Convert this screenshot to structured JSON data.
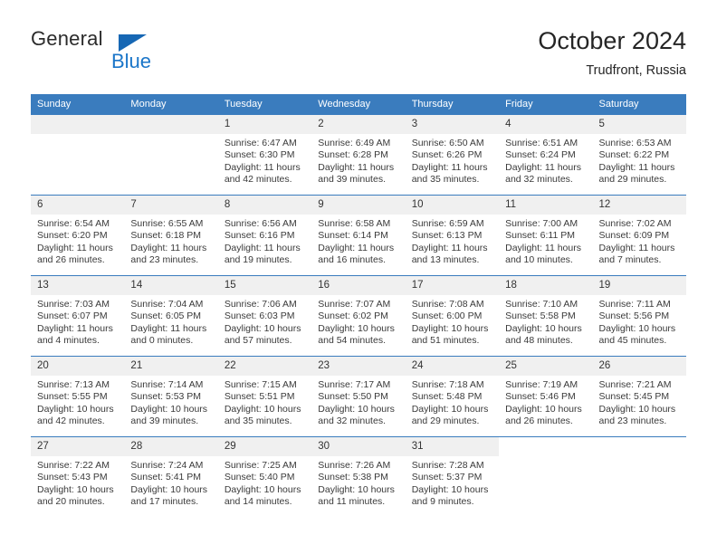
{
  "brand": {
    "name_top": "General",
    "name_bottom": "Blue",
    "accent_color": "#1667b4"
  },
  "header": {
    "title": "October 2024",
    "subtitle": "Trudfront, Russia"
  },
  "theme": {
    "header_blue": "#3a7cbe",
    "daynum_band": "#f0f0f0",
    "text": "#3a3a3a"
  },
  "calendar": {
    "weekday_headers": [
      "Sunday",
      "Monday",
      "Tuesday",
      "Wednesday",
      "Thursday",
      "Friday",
      "Saturday"
    ],
    "weeks": [
      [
        {
          "day": "",
          "blank": true,
          "sunrise": "",
          "sunset": "",
          "daylight_line1": "",
          "daylight_line2": ""
        },
        {
          "day": "",
          "blank": true,
          "sunrise": "",
          "sunset": "",
          "daylight_line1": "",
          "daylight_line2": ""
        },
        {
          "day": "1",
          "sunrise": "Sunrise: 6:47 AM",
          "sunset": "Sunset: 6:30 PM",
          "daylight_line1": "Daylight: 11 hours",
          "daylight_line2": "and 42 minutes."
        },
        {
          "day": "2",
          "sunrise": "Sunrise: 6:49 AM",
          "sunset": "Sunset: 6:28 PM",
          "daylight_line1": "Daylight: 11 hours",
          "daylight_line2": "and 39 minutes."
        },
        {
          "day": "3",
          "sunrise": "Sunrise: 6:50 AM",
          "sunset": "Sunset: 6:26 PM",
          "daylight_line1": "Daylight: 11 hours",
          "daylight_line2": "and 35 minutes."
        },
        {
          "day": "4",
          "sunrise": "Sunrise: 6:51 AM",
          "sunset": "Sunset: 6:24 PM",
          "daylight_line1": "Daylight: 11 hours",
          "daylight_line2": "and 32 minutes."
        },
        {
          "day": "5",
          "sunrise": "Sunrise: 6:53 AM",
          "sunset": "Sunset: 6:22 PM",
          "daylight_line1": "Daylight: 11 hours",
          "daylight_line2": "and 29 minutes."
        }
      ],
      [
        {
          "day": "6",
          "sunrise": "Sunrise: 6:54 AM",
          "sunset": "Sunset: 6:20 PM",
          "daylight_line1": "Daylight: 11 hours",
          "daylight_line2": "and 26 minutes."
        },
        {
          "day": "7",
          "sunrise": "Sunrise: 6:55 AM",
          "sunset": "Sunset: 6:18 PM",
          "daylight_line1": "Daylight: 11 hours",
          "daylight_line2": "and 23 minutes."
        },
        {
          "day": "8",
          "sunrise": "Sunrise: 6:56 AM",
          "sunset": "Sunset: 6:16 PM",
          "daylight_line1": "Daylight: 11 hours",
          "daylight_line2": "and 19 minutes."
        },
        {
          "day": "9",
          "sunrise": "Sunrise: 6:58 AM",
          "sunset": "Sunset: 6:14 PM",
          "daylight_line1": "Daylight: 11 hours",
          "daylight_line2": "and 16 minutes."
        },
        {
          "day": "10",
          "sunrise": "Sunrise: 6:59 AM",
          "sunset": "Sunset: 6:13 PM",
          "daylight_line1": "Daylight: 11 hours",
          "daylight_line2": "and 13 minutes."
        },
        {
          "day": "11",
          "sunrise": "Sunrise: 7:00 AM",
          "sunset": "Sunset: 6:11 PM",
          "daylight_line1": "Daylight: 11 hours",
          "daylight_line2": "and 10 minutes."
        },
        {
          "day": "12",
          "sunrise": "Sunrise: 7:02 AM",
          "sunset": "Sunset: 6:09 PM",
          "daylight_line1": "Daylight: 11 hours",
          "daylight_line2": "and 7 minutes."
        }
      ],
      [
        {
          "day": "13",
          "sunrise": "Sunrise: 7:03 AM",
          "sunset": "Sunset: 6:07 PM",
          "daylight_line1": "Daylight: 11 hours",
          "daylight_line2": "and 4 minutes."
        },
        {
          "day": "14",
          "sunrise": "Sunrise: 7:04 AM",
          "sunset": "Sunset: 6:05 PM",
          "daylight_line1": "Daylight: 11 hours",
          "daylight_line2": "and 0 minutes."
        },
        {
          "day": "15",
          "sunrise": "Sunrise: 7:06 AM",
          "sunset": "Sunset: 6:03 PM",
          "daylight_line1": "Daylight: 10 hours",
          "daylight_line2": "and 57 minutes."
        },
        {
          "day": "16",
          "sunrise": "Sunrise: 7:07 AM",
          "sunset": "Sunset: 6:02 PM",
          "daylight_line1": "Daylight: 10 hours",
          "daylight_line2": "and 54 minutes."
        },
        {
          "day": "17",
          "sunrise": "Sunrise: 7:08 AM",
          "sunset": "Sunset: 6:00 PM",
          "daylight_line1": "Daylight: 10 hours",
          "daylight_line2": "and 51 minutes."
        },
        {
          "day": "18",
          "sunrise": "Sunrise: 7:10 AM",
          "sunset": "Sunset: 5:58 PM",
          "daylight_line1": "Daylight: 10 hours",
          "daylight_line2": "and 48 minutes."
        },
        {
          "day": "19",
          "sunrise": "Sunrise: 7:11 AM",
          "sunset": "Sunset: 5:56 PM",
          "daylight_line1": "Daylight: 10 hours",
          "daylight_line2": "and 45 minutes."
        }
      ],
      [
        {
          "day": "20",
          "sunrise": "Sunrise: 7:13 AM",
          "sunset": "Sunset: 5:55 PM",
          "daylight_line1": "Daylight: 10 hours",
          "daylight_line2": "and 42 minutes."
        },
        {
          "day": "21",
          "sunrise": "Sunrise: 7:14 AM",
          "sunset": "Sunset: 5:53 PM",
          "daylight_line1": "Daylight: 10 hours",
          "daylight_line2": "and 39 minutes."
        },
        {
          "day": "22",
          "sunrise": "Sunrise: 7:15 AM",
          "sunset": "Sunset: 5:51 PM",
          "daylight_line1": "Daylight: 10 hours",
          "daylight_line2": "and 35 minutes."
        },
        {
          "day": "23",
          "sunrise": "Sunrise: 7:17 AM",
          "sunset": "Sunset: 5:50 PM",
          "daylight_line1": "Daylight: 10 hours",
          "daylight_line2": "and 32 minutes."
        },
        {
          "day": "24",
          "sunrise": "Sunrise: 7:18 AM",
          "sunset": "Sunset: 5:48 PM",
          "daylight_line1": "Daylight: 10 hours",
          "daylight_line2": "and 29 minutes."
        },
        {
          "day": "25",
          "sunrise": "Sunrise: 7:19 AM",
          "sunset": "Sunset: 5:46 PM",
          "daylight_line1": "Daylight: 10 hours",
          "daylight_line2": "and 26 minutes."
        },
        {
          "day": "26",
          "sunrise": "Sunrise: 7:21 AM",
          "sunset": "Sunset: 5:45 PM",
          "daylight_line1": "Daylight: 10 hours",
          "daylight_line2": "and 23 minutes."
        }
      ],
      [
        {
          "day": "27",
          "sunrise": "Sunrise: 7:22 AM",
          "sunset": "Sunset: 5:43 PM",
          "daylight_line1": "Daylight: 10 hours",
          "daylight_line2": "and 20 minutes."
        },
        {
          "day": "28",
          "sunrise": "Sunrise: 7:24 AM",
          "sunset": "Sunset: 5:41 PM",
          "daylight_line1": "Daylight: 10 hours",
          "daylight_line2": "and 17 minutes."
        },
        {
          "day": "29",
          "sunrise": "Sunrise: 7:25 AM",
          "sunset": "Sunset: 5:40 PM",
          "daylight_line1": "Daylight: 10 hours",
          "daylight_line2": "and 14 minutes."
        },
        {
          "day": "30",
          "sunrise": "Sunrise: 7:26 AM",
          "sunset": "Sunset: 5:38 PM",
          "daylight_line1": "Daylight: 10 hours",
          "daylight_line2": "and 11 minutes."
        },
        {
          "day": "31",
          "sunrise": "Sunrise: 7:28 AM",
          "sunset": "Sunset: 5:37 PM",
          "daylight_line1": "Daylight: 10 hours",
          "daylight_line2": "and 9 minutes."
        },
        {
          "day": "",
          "blank": true,
          "sunrise": "",
          "sunset": "",
          "daylight_line1": "",
          "daylight_line2": ""
        },
        {
          "day": "",
          "blank": true,
          "sunrise": "",
          "sunset": "",
          "daylight_line1": "",
          "daylight_line2": ""
        }
      ]
    ]
  }
}
